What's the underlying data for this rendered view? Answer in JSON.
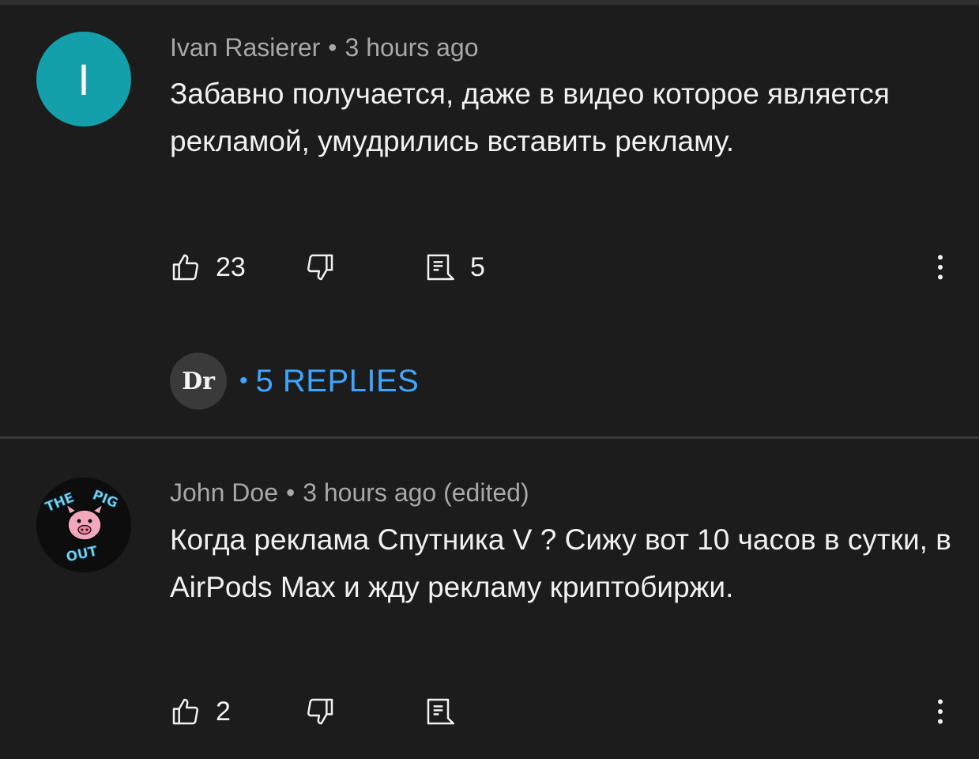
{
  "comments": [
    {
      "author": "Ivan Rasierer",
      "time": "3 hours ago",
      "avatar_letter": "I",
      "avatar_color": "#13a0ab",
      "text": "Забавно получается, даже в видео которое является рекламой, умудрились вставить рекламу.",
      "likes": "23",
      "replies_count": "5",
      "replies_avatar_text": "Dr",
      "replies_link": "5 REPLIES"
    },
    {
      "author": "John Doe",
      "time": "3 hours ago (edited)",
      "avatar_logo_text": "THE PIG OUT",
      "text": "Когда реклама Спутника V ? Сижу вот 10 часов в сутки, в AirPods  Max  и жду рекламу криптобиржи.",
      "likes": "2"
    }
  ],
  "icons": {
    "like": "thumbs-up-icon",
    "dislike": "thumbs-down-icon",
    "reply": "comment-icon",
    "more": "more-vertical-icon"
  },
  "colors": {
    "background": "#1c1c1c",
    "link": "#3ea6ff",
    "meta": "#a8a8a8"
  }
}
